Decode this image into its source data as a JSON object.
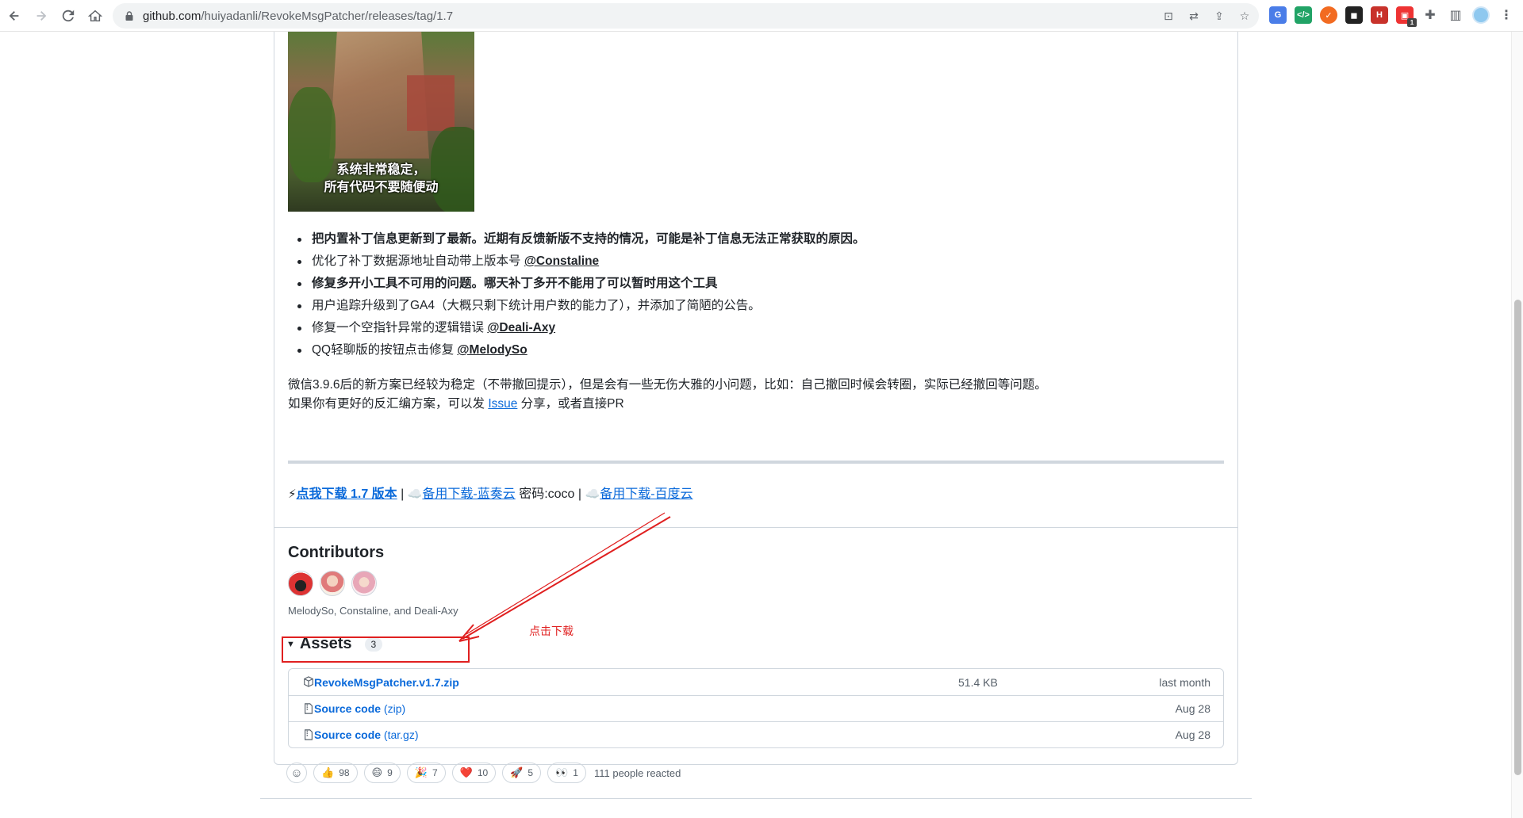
{
  "browser": {
    "url_host": "github.com",
    "url_path": "/huiyadanli/RevokeMsgPatcher/releases/tag/1.7",
    "extension_badge": "1"
  },
  "hero": {
    "caption_line1": "系统非常稳定，",
    "caption_line2": "所有代码不要随便动"
  },
  "notes": {
    "items": [
      {
        "text": "把内置补丁信息更新到了最新。近期有反馈新版不支持的情况，可能是补丁信息无法正常获取的原因。",
        "mention": "",
        "bold": true
      },
      {
        "text": "优化了补丁数据源地址自动带上版本号 ",
        "mention": "@Constaline",
        "bold": false
      },
      {
        "text": "修复多开小工具不可用的问题。哪天补丁多开不能用了可以暂时用这个工具",
        "mention": "",
        "bold": true
      },
      {
        "text": "用户追踪升级到了GA4（大概只剩下统计用户数的能力了），并添加了简陋的公告。",
        "mention": "",
        "bold": false
      },
      {
        "text": "修复一个空指针异常的逻辑错误 ",
        "mention": "@Deali-Axy",
        "bold": false
      },
      {
        "text": "QQ轻聊版的按钮点击修复 ",
        "mention": "@MelodySo",
        "bold": false
      }
    ],
    "para1": "微信3.9.6后的新方案已经较为稳定（不带撤回提示），但是会有一些无伤大雅的小问题，比如：自己撤回时候会转圈，实际已经撤回等问题。",
    "para2_before": "如果你有更好的反汇编方案，可以发 ",
    "para2_link": "Issue",
    "para2_after": " 分享，或者直接PR"
  },
  "downloads": {
    "primary_emoji": "⚡",
    "primary": "点我下载 1.7 版本",
    "sep1": " | ",
    "cloud_emoji": "☁️",
    "lanzou": "备用下载-蓝奏云",
    "lanzou_pw": " 密码:coco",
    "sep2": " | ",
    "baidu": "备用下载-百度云"
  },
  "contributors": {
    "title": "Contributors",
    "names": "MelodySo, Constaline, and Deali-Axy"
  },
  "assets": {
    "title": "Assets",
    "count": "3",
    "rows": [
      {
        "name": "RevokeMsgPatcher.v1.7.zip",
        "sub": "",
        "size": "51.4 KB",
        "date": "last month",
        "icon": "package-icon"
      },
      {
        "name": "Source code",
        "sub": " (zip)",
        "size": "",
        "date": "Aug 28",
        "icon": "file-zip-icon"
      },
      {
        "name": "Source code",
        "sub": " (tar.gz)",
        "size": "",
        "date": "Aug 28",
        "icon": "file-zip-icon"
      }
    ]
  },
  "reactions": {
    "items": [
      {
        "emoji": "👍",
        "count": "98"
      },
      {
        "emoji": "😄",
        "count": "9"
      },
      {
        "emoji": "🎉",
        "count": "7"
      },
      {
        "emoji": "❤️",
        "count": "10"
      },
      {
        "emoji": "🚀",
        "count": "5"
      },
      {
        "emoji": "👀",
        "count": "1"
      }
    ],
    "summary": "111 people reacted"
  },
  "annotation": {
    "text": "点击下载",
    "color": "#e02020"
  },
  "colors": {
    "link": "#0969da",
    "border": "#d0d7de",
    "muted": "#57606a"
  }
}
